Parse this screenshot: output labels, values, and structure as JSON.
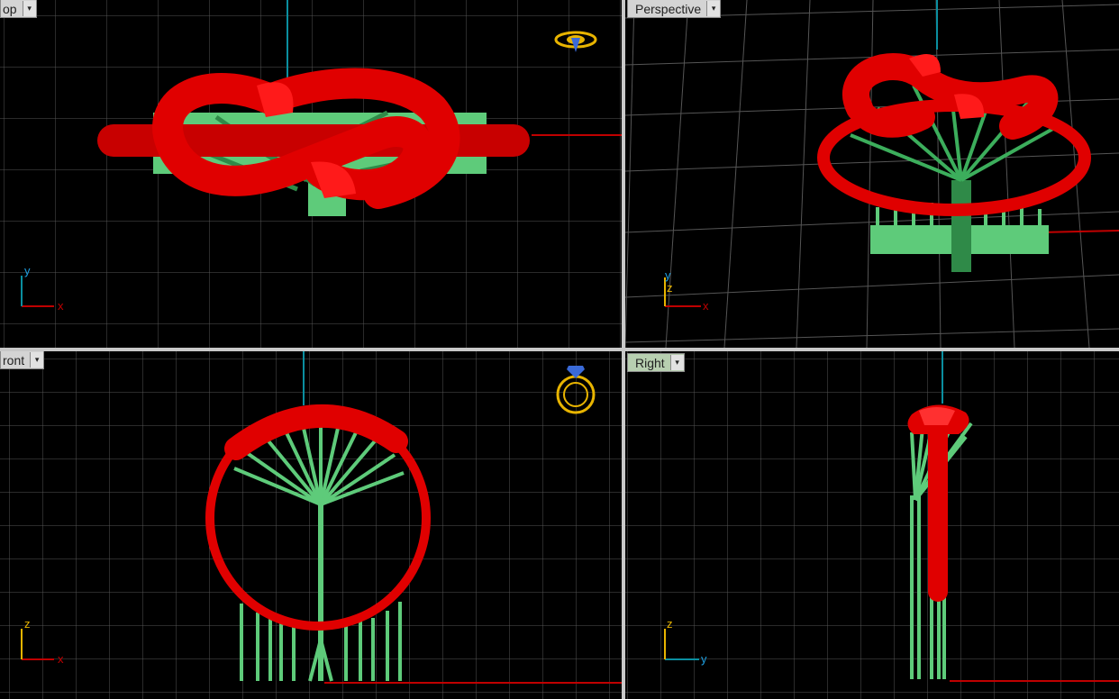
{
  "colors": {
    "background": "#000000",
    "grid": "#5a5a5a",
    "x_axis": "#c00000",
    "y_axis": "#0b8fa0",
    "ring": "#ee0000",
    "supports": "#5ecb7a",
    "icon_gold": "#e8b400"
  },
  "viewports": {
    "top": {
      "label": "op",
      "axis_a": "y",
      "axis_b": "x",
      "icon": "ring-top-icon"
    },
    "perspective": {
      "label": "Perspective",
      "axis_a": "y",
      "axis_b": "x",
      "axis_c": "z",
      "icon": ""
    },
    "front": {
      "label": "ront",
      "axis_a": "z",
      "axis_b": "x",
      "icon": "ring-front-icon"
    },
    "right": {
      "label": "Right",
      "axis_a": "z",
      "axis_b": "y",
      "icon": ""
    }
  },
  "dropdown_icon": "▾"
}
